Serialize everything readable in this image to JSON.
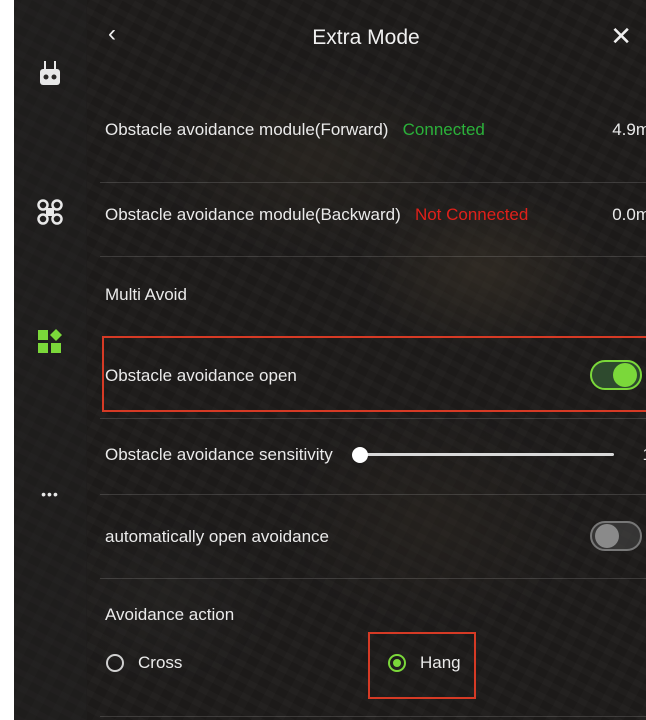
{
  "header": {
    "back_icon": "chevron-left-icon",
    "back_glyph": "‹",
    "title": "Extra Mode",
    "close_icon": "close-icon",
    "close_glyph": "✕"
  },
  "sidebar": {
    "items": [
      {
        "name": "remote-controller-icon"
      },
      {
        "name": "drone-icon"
      },
      {
        "name": "apps-icon",
        "active": true
      },
      {
        "name": "more-icon",
        "glyph": "•••"
      }
    ]
  },
  "modules": [
    {
      "label": "Obstacle avoidance module(Forward)",
      "status": "Connected",
      "value": "4.9m"
    },
    {
      "label": "Obstacle avoidance module(Backward)",
      "status": "Not Connected",
      "value": "0.0m"
    }
  ],
  "multi_avoid": {
    "label": "Multi Avoid"
  },
  "avoidance_open": {
    "label": "Obstacle avoidance open",
    "enabled": true
  },
  "sensitivity": {
    "label": "Obstacle avoidance sensitivity",
    "value": "1",
    "level": 0.0
  },
  "auto_open": {
    "label": "automatically open avoidance",
    "enabled": false
  },
  "avoidance_action": {
    "label": "Avoidance action",
    "options": [
      {
        "label": "Cross",
        "selected": false
      },
      {
        "label": "Hang",
        "selected": true
      }
    ]
  },
  "colors": {
    "accent": "#7bd83a",
    "connected": "#2bb13a",
    "not_connected": "#e0201a",
    "highlight": "#d63a25"
  }
}
